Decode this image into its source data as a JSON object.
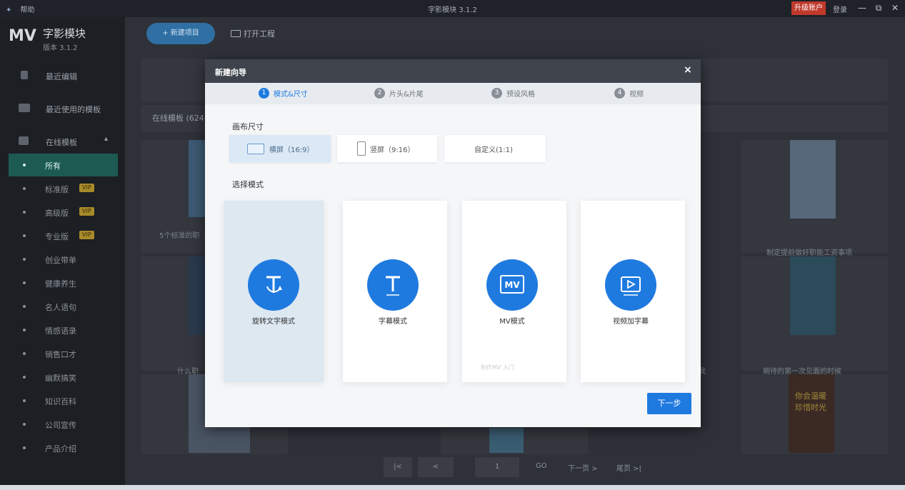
{
  "titlebar": {
    "help": "帮助",
    "title": "字影模块 3.1.2",
    "upgrade": "升级账户",
    "login": "登录",
    "controls": [
      "—",
      "⧉",
      "✕"
    ]
  },
  "brand": {
    "logo": "MV",
    "name": "字影模块",
    "version": "版本 3.1.2"
  },
  "sidebar": {
    "top_items": [
      {
        "label": "最近编辑",
        "icon": "file-icon"
      },
      {
        "label": "最近使用的模板",
        "icon": "template-icon"
      },
      {
        "label": "在线模板",
        "icon": "monitor-icon"
      }
    ],
    "sub_items": [
      {
        "label": "所有",
        "active": true
      },
      {
        "label": "标准版",
        "badge": "VIP"
      },
      {
        "label": "高级版",
        "badge": "VIP"
      },
      {
        "label": "专业版",
        "badge": "VIP"
      },
      {
        "label": "创业带单"
      },
      {
        "label": "健康养生"
      },
      {
        "label": "名人语句"
      },
      {
        "label": "情感语录"
      },
      {
        "label": "销售口才"
      },
      {
        "label": "幽默搞笑"
      },
      {
        "label": "知识百科"
      },
      {
        "label": "公司宣传"
      },
      {
        "label": "产品介绍"
      }
    ]
  },
  "main": {
    "new_project": "+ 新建项目",
    "open_project": "打开工程",
    "online_label": "在线模板 (624",
    "captions": {
      "c1": "5个标准的职",
      "c2": "制定提前做好职能工资事项",
      "c3": "什么职",
      "c4": "期待的第一次见面的时候",
      "c5": "我",
      "c6": "你会温暖",
      "c7": "珍惜时光"
    },
    "pager": {
      "first": "|<",
      "prev": "<",
      "page": "1",
      "go": "GO",
      "next": "下一页 >",
      "last": "尾页 >|"
    }
  },
  "dialog": {
    "title": "新建向导",
    "close": "×",
    "steps": [
      {
        "num": "1",
        "label": "模式&尺寸",
        "active": true
      },
      {
        "num": "2",
        "label": "片头&片尾",
        "active": false
      },
      {
        "num": "3",
        "label": "预设风格",
        "active": false
      },
      {
        "num": "4",
        "label": "视频",
        "active": false
      }
    ],
    "canvas_label": "画布尺寸",
    "sizes": [
      {
        "label": "横屏（16:9）",
        "selected": true,
        "icon": "landscape-icon"
      },
      {
        "label": "竖屏（9:16）",
        "selected": false,
        "icon": "portrait-icon"
      },
      {
        "label": "自定义(1:1)",
        "selected": false
      }
    ],
    "mode_label": "选择模式",
    "modes": [
      {
        "label": "旋转文字模式",
        "icon": "rotate-text-icon",
        "selected": true
      },
      {
        "label": "字幕模式",
        "icon": "text-icon",
        "selected": false
      },
      {
        "label": "MV模式",
        "icon": "mv-icon",
        "selected": false,
        "faint": "制作MV 入门"
      },
      {
        "label": "视频加字幕",
        "icon": "play-icon",
        "selected": false
      }
    ],
    "next": "下一步"
  },
  "colors": {
    "accent": "#1f7ae0",
    "sidebar_active": "#1c5a52",
    "dialog_header": "#3e434c",
    "upgrade": "#c0392b"
  }
}
